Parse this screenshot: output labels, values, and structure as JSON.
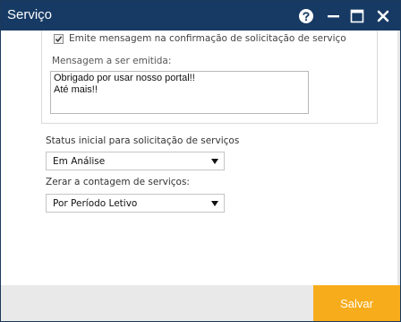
{
  "window": {
    "title": "Serviço",
    "accent_color": "#173a64",
    "controls": [
      "help-icon",
      "minimize-icon",
      "maximize-icon",
      "close-icon"
    ]
  },
  "message_panel": {
    "checkbox_label": "Emite mensagem na confirmação de solicitação de serviço",
    "checkbox_checked": true,
    "message_label": "Mensagem a ser emitida:",
    "message_lines": [
      "Obrigado por usar nosso portal!!",
      "Até mais!!"
    ]
  },
  "status_field": {
    "label": "Status inicial para solicitação de serviços",
    "value": "Em Análise"
  },
  "reset_field": {
    "label": "Zerar a contagem de serviços:",
    "value": "Por Período Letivo"
  },
  "footer": {
    "save_label": "Salvar",
    "save_color": "#f7ac1b"
  }
}
